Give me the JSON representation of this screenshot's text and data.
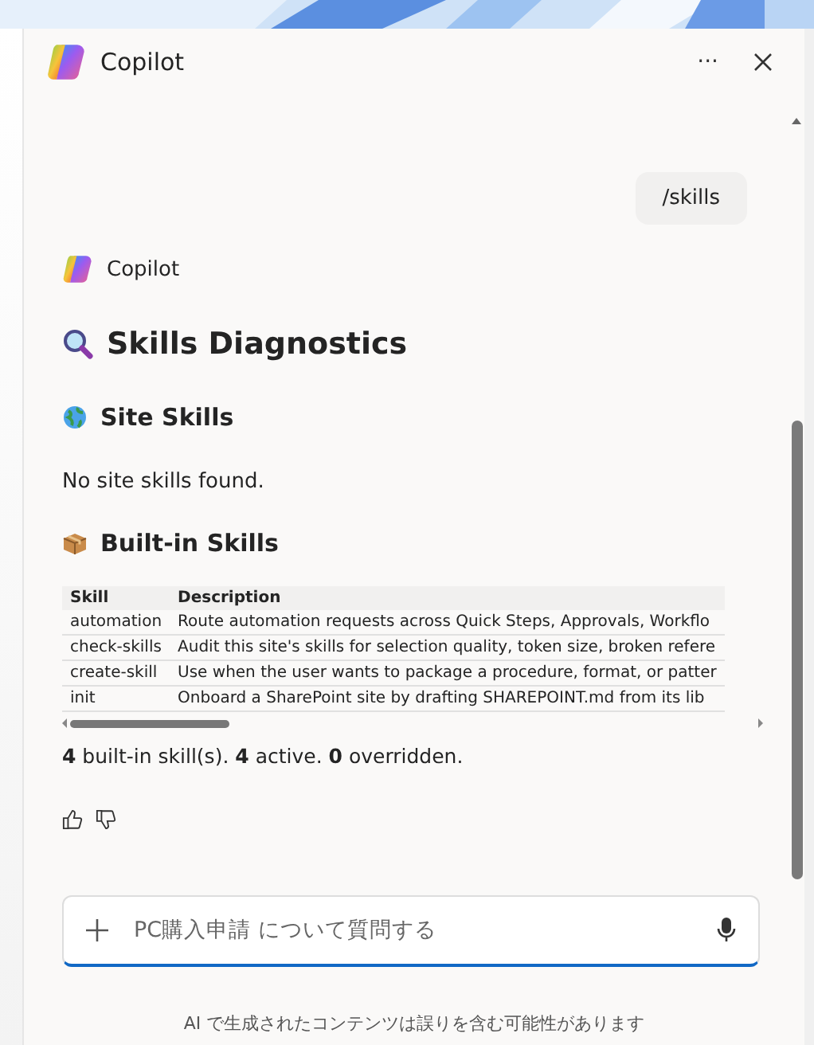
{
  "header": {
    "title": "Copilot",
    "more_button": "···"
  },
  "user_message": "/skills",
  "response": {
    "sender": "Copilot",
    "title": "Skills Diagnostics",
    "sections": [
      {
        "kind": "globe",
        "heading": "Site Skills",
        "text": "No site skills found."
      },
      {
        "kind": "package",
        "heading": "Built-in Skills",
        "table": {
          "columns": [
            "Skill",
            "Description"
          ],
          "rows": [
            [
              "automation",
              "Route automation requests across Quick Steps, Approvals, Workflo"
            ],
            [
              "check-skills",
              "Audit this site's skills for selection quality, token size, broken refere"
            ],
            [
              "create-skill",
              "Use when the user wants to package a procedure, format, or patter"
            ],
            [
              "init",
              "Onboard a SharePoint site by drafting SHAREPOINT.md from its lib"
            ]
          ]
        }
      }
    ],
    "summary": "**4** built-in skill(s). **4** active. **0** overridden."
  },
  "composer": {
    "placeholder": "PC購入申請 について質問する"
  },
  "disclaimer": "AI で生成されたコンテンツは誤りを含む可能性があります"
}
